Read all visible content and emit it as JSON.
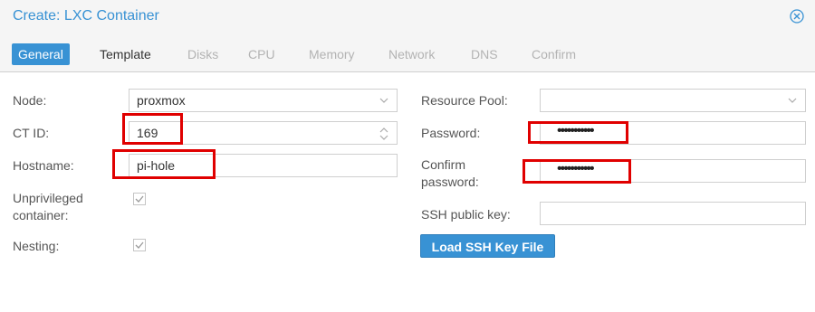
{
  "dialog": {
    "title": "Create: LXC Container"
  },
  "tabs": [
    {
      "label": "General",
      "state": "active"
    },
    {
      "label": "Template",
      "state": "normal"
    },
    {
      "label": "Disks",
      "state": "disabled"
    },
    {
      "label": "CPU",
      "state": "disabled"
    },
    {
      "label": "Memory",
      "state": "disabled"
    },
    {
      "label": "Network",
      "state": "disabled"
    },
    {
      "label": "DNS",
      "state": "disabled"
    },
    {
      "label": "Confirm",
      "state": "disabled"
    }
  ],
  "left": {
    "node": {
      "label": "Node:",
      "value": "proxmox"
    },
    "ctid": {
      "label": "CT ID:",
      "value": "169"
    },
    "hostname": {
      "label": "Hostname:",
      "value": "pi-hole"
    },
    "unprivileged": {
      "label_line1": "Unprivileged",
      "label_line2": "container:",
      "checked": true
    },
    "nesting": {
      "label": "Nesting:",
      "checked": true
    }
  },
  "right": {
    "pool": {
      "label": "Resource Pool:",
      "value": ""
    },
    "password": {
      "label": "Password:",
      "value": "•••••••••••"
    },
    "confirm": {
      "label_line1": "Confirm",
      "label_line2": "password:",
      "value": "•••••••••••"
    },
    "sshkey": {
      "label": "SSH public key:",
      "value": ""
    },
    "load_button": "Load SSH Key File"
  },
  "colors": {
    "accent": "#3892d4",
    "highlight": "#e00000"
  },
  "icons": [
    "close-icon",
    "chevron-down-icon",
    "spinner-icon",
    "checkmark-icon"
  ]
}
